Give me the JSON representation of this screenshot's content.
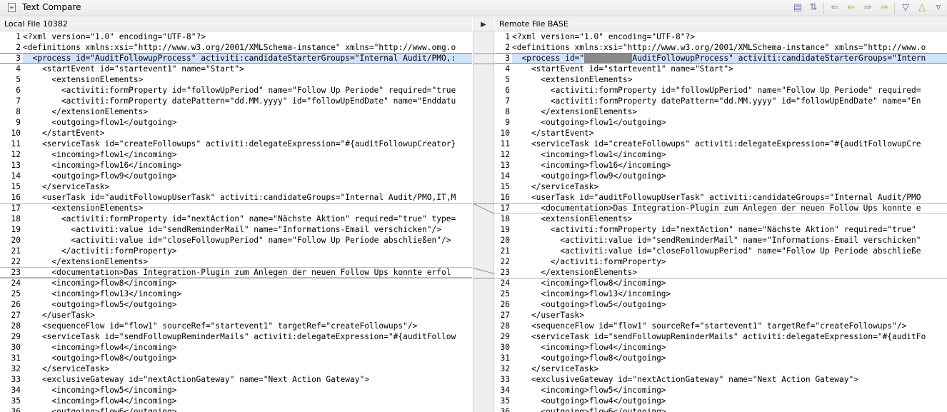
{
  "window": {
    "title": "Text Compare"
  },
  "toolbar": {
    "icons": [
      "layout-icon",
      "ignore-whitespace-icon",
      "copy-all-left-icon",
      "copy-current-left-icon",
      "copy-all-right-icon",
      "copy-current-right-icon",
      "next-difference-icon",
      "previous-difference-icon",
      "next-change-icon"
    ]
  },
  "left": {
    "header": "Local File 10382",
    "lines": [
      {
        "n": "1",
        "t": "<?xml version=\"1.0\" encoding=\"UTF-8\"?>"
      },
      {
        "n": "2",
        "t": "<definitions xmlns:xsi=\"http://www.w3.org/2001/XMLSchema-instance\" xmlns=\"http://www.omg.o"
      },
      {
        "n": "3",
        "t": "  <process id=\"AuditFollowupProcess\" activiti:candidateStarterGroups=\"Internal Audit/PMO,:"
      },
      {
        "n": "4",
        "t": "    <startEvent id=\"startevent1\" name=\"Start\">"
      },
      {
        "n": "5",
        "t": "      <extensionElements>"
      },
      {
        "n": "6",
        "t": "        <activiti:formProperty id=\"followUpPeriod\" name=\"Follow Up Periode\" required=\"true"
      },
      {
        "n": "7",
        "t": "        <activiti:formProperty datePattern=\"dd.MM.yyyy\" id=\"followUpEndDate\" name=\"Enddatu"
      },
      {
        "n": "8",
        "t": "      </extensionElements>"
      },
      {
        "n": "9",
        "t": "      <outgoing>flow1</outgoing>"
      },
      {
        "n": "10",
        "t": "    </startEvent>"
      },
      {
        "n": "11",
        "t": "    <serviceTask id=\"createFollowups\" activiti:delegateExpression=\"#{auditFollowupCreator}"
      },
      {
        "n": "12",
        "t": "      <incoming>flow1</incoming>"
      },
      {
        "n": "13",
        "t": "      <incoming>flow16</incoming>"
      },
      {
        "n": "14",
        "t": "      <outgoing>flow9</outgoing>"
      },
      {
        "n": "15",
        "t": "    </serviceTask>"
      },
      {
        "n": "16",
        "t": "    <userTask id=\"auditFollowupUserTask\" activiti:candidateGroups=\"Internal Audit/PMO,IT,M"
      },
      {
        "n": "17",
        "t": "      <extensionElements>"
      },
      {
        "n": "18",
        "t": "        <activiti:formProperty id=\"nextAction\" name=\"Nächste Aktion\" required=\"true\" type="
      },
      {
        "n": "19",
        "t": "          <activiti:value id=\"sendReminderMail\" name=\"Informations-Email verschicken\"/>"
      },
      {
        "n": "20",
        "t": "          <activiti:value id=\"closeFollowupPeriod\" name=\"Follow Up Periode abschließen\"/>"
      },
      {
        "n": "21",
        "t": "        </activiti:formProperty>"
      },
      {
        "n": "22",
        "t": "      </extensionElements>"
      },
      {
        "n": "23",
        "t": "      <documentation>Das Integration-Plugin zum Anlegen der neuen Follow Ups konnte erfol"
      },
      {
        "n": "24",
        "t": "      <incoming>flow8</incoming>"
      },
      {
        "n": "25",
        "t": "      <incoming>flow13</incoming>"
      },
      {
        "n": "26",
        "t": "      <outgoing>flow5</outgoing>"
      },
      {
        "n": "27",
        "t": "    </userTask>"
      },
      {
        "n": "28",
        "t": "    <sequenceFlow id=\"flow1\" sourceRef=\"startevent1\" targetRef=\"createFollowups\"/>"
      },
      {
        "n": "29",
        "t": "    <serviceTask id=\"sendFollowupReminderMails\" activiti:delegateExpression=\"#{auditFollow"
      },
      {
        "n": "30",
        "t": "      <incoming>flow4</incoming>"
      },
      {
        "n": "31",
        "t": "      <outgoing>flow8</outgoing>"
      },
      {
        "n": "32",
        "t": "    </serviceTask>"
      },
      {
        "n": "33",
        "t": "    <exclusiveGateway id=\"nextActionGateway\" name=\"Next Action Gateway\">"
      },
      {
        "n": "34",
        "t": "      <incoming>flow5</incoming>"
      },
      {
        "n": "35",
        "t": "      <incoming>flow4</incoming>"
      },
      {
        "n": "36",
        "t": "      <outgoing>flow6</outgoing>"
      }
    ]
  },
  "right": {
    "header": "Remote File BASE",
    "lines": [
      {
        "n": "1",
        "t": "<?xml version=\"1.0\" encoding=\"UTF-8\"?>"
      },
      {
        "n": "2",
        "t": "<definitions xmlns:xsi=\"http://www.w3.org/2001/XMLSchema-instance\" xmlns=\"http://www.o"
      },
      {
        "n": "3",
        "t": "  <process id=\"",
        "redacted": "XXXXXXXXXX",
        "t2": "AuditFollowupProcess\" activiti:candidateStarterGroups=\"Intern"
      },
      {
        "n": "4",
        "t": "    <startEvent id=\"startevent1\" name=\"Start\">"
      },
      {
        "n": "5",
        "t": "      <extensionElements>"
      },
      {
        "n": "6",
        "t": "        <activiti:formProperty id=\"followUpPeriod\" name=\"Follow Up Periode\" required="
      },
      {
        "n": "7",
        "t": "        <activiti:formProperty datePattern=\"dd.MM.yyyy\" id=\"followUpEndDate\" name=\"En"
      },
      {
        "n": "8",
        "t": "      </extensionElements>"
      },
      {
        "n": "9",
        "t": "      <outgoing>flow1</outgoing>"
      },
      {
        "n": "10",
        "t": "    </startEvent>"
      },
      {
        "n": "11",
        "t": "    <serviceTask id=\"createFollowups\" activiti:delegateExpression=\"#{auditFollowupCre"
      },
      {
        "n": "12",
        "t": "      <incoming>flow1</incoming>"
      },
      {
        "n": "13",
        "t": "      <incoming>flow16</incoming>"
      },
      {
        "n": "14",
        "t": "      <outgoing>flow9</outgoing>"
      },
      {
        "n": "15",
        "t": "    </serviceTask>"
      },
      {
        "n": "16",
        "t": "    <userTask id=\"auditFollowupUserTask\" activiti:candidateGroups=\"Internal Audit/PMO"
      },
      {
        "n": "17",
        "t": "      <documentation>Das Integration-Plugin zum Anlegen der neuen Follow Ups konnte e"
      },
      {
        "n": "18",
        "t": "      <extensionElements>"
      },
      {
        "n": "19",
        "t": "        <activiti:formProperty id=\"nextAction\" name=\"Nächste Aktion\" required=\"true\" "
      },
      {
        "n": "20",
        "t": "          <activiti:value id=\"sendReminderMail\" name=\"Informations-Email verschicken\""
      },
      {
        "n": "21",
        "t": "          <activiti:value id=\"closeFollowupPeriod\" name=\"Follow Up Periode abschließe"
      },
      {
        "n": "22",
        "t": "        </activiti:formProperty>"
      },
      {
        "n": "23",
        "t": "      </extensionElements>"
      },
      {
        "n": "24",
        "t": "      <incoming>flow8</incoming>"
      },
      {
        "n": "25",
        "t": "      <incoming>flow13</incoming>"
      },
      {
        "n": "26",
        "t": "      <outgoing>flow5</outgoing>"
      },
      {
        "n": "27",
        "t": "    </userTask>"
      },
      {
        "n": "28",
        "t": "    <sequenceFlow id=\"flow1\" sourceRef=\"startevent1\" targetRef=\"createFollowups\"/>"
      },
      {
        "n": "29",
        "t": "    <serviceTask id=\"sendFollowupReminderMails\" activiti:delegateExpression=\"#{auditFo"
      },
      {
        "n": "30",
        "t": "      <incoming>flow4</incoming>"
      },
      {
        "n": "31",
        "t": "      <outgoing>flow8</outgoing>"
      },
      {
        "n": "32",
        "t": "    </serviceTask>"
      },
      {
        "n": "33",
        "t": "    <exclusiveGateway id=\"nextActionGateway\" name=\"Next Action Gateway\">"
      },
      {
        "n": "34",
        "t": "      <incoming>flow5</incoming>"
      },
      {
        "n": "35",
        "t": "      <outgoing>flow4</outgoing>"
      },
      {
        "n": "36",
        "t": "      <outgoing>flow6</outgoing>"
      }
    ]
  },
  "colors": {
    "selected_row": "#cfe3f9",
    "separator": "#a9a9a9"
  }
}
